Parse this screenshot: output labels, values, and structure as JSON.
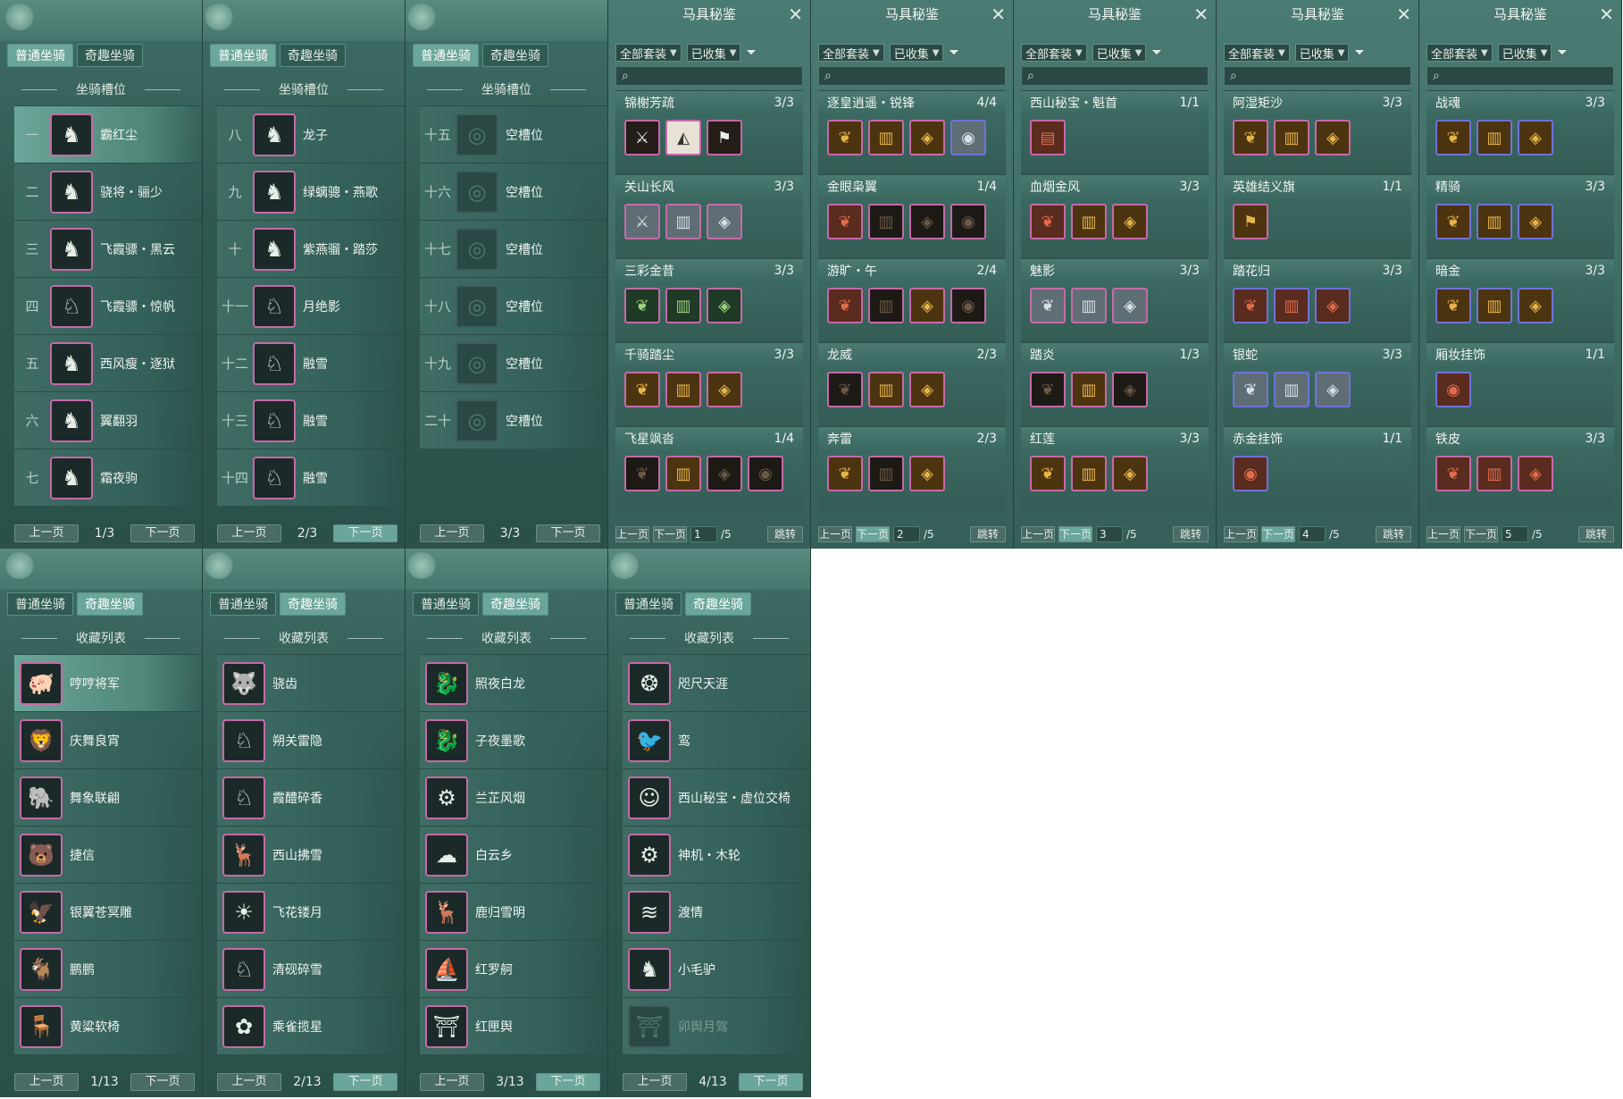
{
  "common": {
    "tab_normal": "普通坐骑",
    "tab_fun": "奇趣坐骑",
    "prev": "上一页",
    "next": "下一页"
  },
  "slot_panels": [
    {
      "section": "坐骑槽位",
      "page": "1/3",
      "rows": [
        [
          "一",
          "霸红尘"
        ],
        [
          "二",
          "骁将・骊少"
        ],
        [
          "三",
          "飞霞骠・黑云"
        ],
        [
          "四",
          "飞霞骠・惊帆"
        ],
        [
          "五",
          "西风瘦・逐狱"
        ],
        [
          "六",
          "翼翻羽"
        ],
        [
          "七",
          "霜夜驹"
        ]
      ]
    },
    {
      "section": "坐骑槽位",
      "page": "2/3",
      "rows": [
        [
          "八",
          "龙子"
        ],
        [
          "九",
          "绿螭骢・燕歌"
        ],
        [
          "十",
          "紫燕骝・踏莎"
        ],
        [
          "十一",
          "月绝影"
        ],
        [
          "十二",
          "融雪"
        ],
        [
          "十三",
          "融雪"
        ],
        [
          "十四",
          "融雪"
        ]
      ]
    },
    {
      "section": "坐骑槽位",
      "page": "3/3",
      "rows": [
        [
          "十五",
          "空槽位"
        ],
        [
          "十六",
          "空槽位"
        ],
        [
          "十七",
          "空槽位"
        ],
        [
          "十八",
          "空槽位"
        ],
        [
          "十九",
          "空槽位"
        ],
        [
          "二十",
          "空槽位"
        ]
      ]
    }
  ],
  "collect_panels": [
    {
      "section": "收藏列表",
      "page": "1/13",
      "rows": [
        "哼哼将军",
        "庆舞良宵",
        "舞象联翩",
        "捷信",
        "银翼苍冥雕",
        "鹏鹏",
        "黄粱软椅"
      ]
    },
    {
      "section": "收藏列表",
      "page": "2/13",
      "rows": [
        "骁齿",
        "朔关雷隐",
        "霞醴碎香",
        "西山拂雪",
        "飞花镂月",
        "清砚碎雪",
        "乘雀揽星"
      ]
    },
    {
      "section": "收藏列表",
      "page": "3/13",
      "rows": [
        "照夜白龙",
        "子夜墨歌",
        "兰芷风烟",
        "白云乡",
        "鹿归雪明",
        "红罗舸",
        "红匣舆"
      ]
    },
    {
      "section": "收藏列表",
      "page": "4/13",
      "rows": [
        "咫尺天涯",
        "鸾",
        "西山秘宝・虚位交椅",
        "神机・木轮",
        "渡情",
        "小毛驴",
        "卯舆月驾"
      ]
    }
  ],
  "tack": {
    "title": "马具秘鉴",
    "filter_all": "全部套装",
    "filter_collected": "已收集",
    "jump": "跳转",
    "total": "/5",
    "prev_s": "上一页",
    "next_s": "下一页"
  },
  "tack_panels": [
    {
      "page": "1",
      "sets": [
        {
          "name": "锦榭芳疏",
          "count": "3/3"
        },
        {
          "name": "关山长风",
          "count": "3/3"
        },
        {
          "name": "三彩金昔",
          "count": "3/3"
        },
        {
          "name": "千骑踏尘",
          "count": "3/3"
        },
        {
          "name": "飞星飒沓",
          "count": "1/4"
        }
      ]
    },
    {
      "page": "2",
      "sets": [
        {
          "name": "逐皇逍遥・锐锋",
          "count": "4/4"
        },
        {
          "name": "金眼枭翼",
          "count": "1/4"
        },
        {
          "name": "游旷・午",
          "count": "2/4"
        },
        {
          "name": "龙威",
          "count": "2/3"
        },
        {
          "name": "奔雷",
          "count": "2/3"
        }
      ]
    },
    {
      "page": "3",
      "sets": [
        {
          "name": "西山秘宝・魁首",
          "count": "1/1"
        },
        {
          "name": "血烟金风",
          "count": "3/3"
        },
        {
          "name": "魅影",
          "count": "3/3"
        },
        {
          "name": "踏炎",
          "count": "1/3"
        },
        {
          "name": "红莲",
          "count": "3/3"
        }
      ]
    },
    {
      "page": "4",
      "sets": [
        {
          "name": "阿湿矩沙",
          "count": "3/3"
        },
        {
          "name": "英雄结义旗",
          "count": "1/1"
        },
        {
          "name": "踏花归",
          "count": "3/3"
        },
        {
          "name": "银蛇",
          "count": "3/3"
        },
        {
          "name": "赤金挂饰",
          "count": "1/1"
        }
      ]
    },
    {
      "page": "5",
      "sets": [
        {
          "name": "战魂",
          "count": "3/3"
        },
        {
          "name": "精骑",
          "count": "3/3"
        },
        {
          "name": "暗金",
          "count": "3/3"
        },
        {
          "name": "厢妆挂饰",
          "count": "1/1"
        },
        {
          "name": "铁皮",
          "count": "3/3"
        }
      ]
    }
  ],
  "colors": {
    "accent": "#6aa699",
    "panel": "#2f5850",
    "rare_border": "#c66aa8",
    "blue_border": "#6f72d9"
  }
}
